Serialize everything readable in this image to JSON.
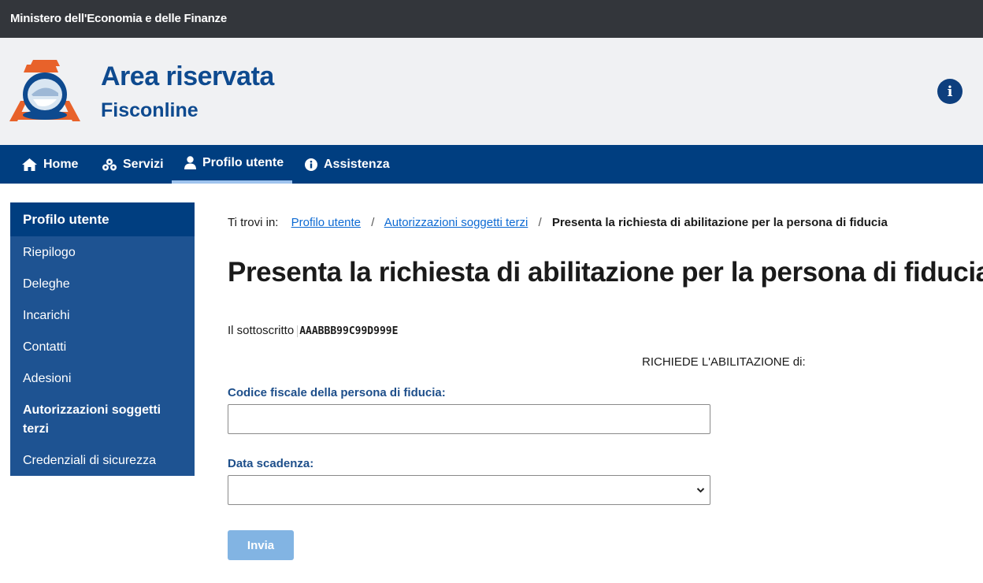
{
  "topbar": {
    "org": "Ministero dell'Economia e delle Finanze"
  },
  "header": {
    "title": "Area riservata",
    "subtitle": "Fisconline",
    "logo_icon": "agenzia-entrate-logo",
    "info_icon": "info-icon"
  },
  "colors": {
    "brand_blue": "#003e80",
    "sidebar_blue": "#1e5392",
    "link": "#0d6ad3",
    "label": "#1d4e8a",
    "logo_orange": "#e8622a",
    "button_disabled": "#82b4e3"
  },
  "nav": {
    "items": [
      {
        "label": "Home",
        "icon": "home-icon"
      },
      {
        "label": "Servizi",
        "icon": "services-icon"
      },
      {
        "label": "Profilo utente",
        "icon": "user-icon",
        "active": true
      },
      {
        "label": "Assistenza",
        "icon": "info-circle-icon"
      }
    ]
  },
  "sidebar": {
    "header": "Profilo utente",
    "items": [
      {
        "label": "Riepilogo"
      },
      {
        "label": "Deleghe"
      },
      {
        "label": "Incarichi"
      },
      {
        "label": "Contatti"
      },
      {
        "label": "Adesioni"
      },
      {
        "label": "Autorizzazioni soggetti terzi",
        "current": true
      },
      {
        "label": "Credenziali di sicurezza"
      }
    ]
  },
  "breadcrumb": {
    "prefix": "Ti trovi in:",
    "links": [
      "Profilo utente",
      "Autorizzazioni soggetti terzi"
    ],
    "separator": "/",
    "current": "Presenta la richiesta di abilitazione per la persona di fiducia"
  },
  "main": {
    "title": "Presenta la richiesta di abilitazione per la persona di fiducia",
    "undersigned_label": "Il sottoscritto",
    "undersigned_cf": "AAABBB99C99D999E",
    "requests": "RICHIEDE L'ABILITAZIONE di:",
    "cf_label": "Codice fiscale della persona di fiducia:",
    "cf_value": "",
    "expiry_label": "Data scadenza:",
    "expiry_value": "",
    "submit": "Invia"
  }
}
